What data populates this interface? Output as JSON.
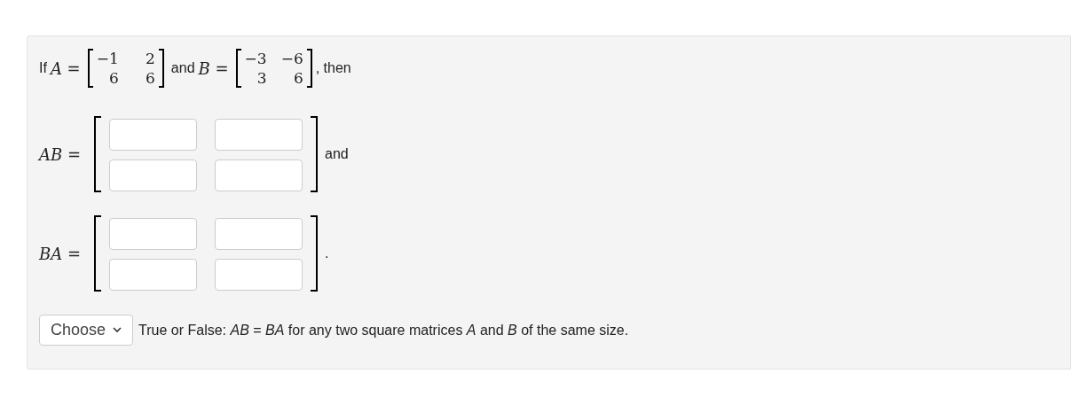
{
  "intro": {
    "prefix": "If",
    "a_label": "*A* =",
    "matrix_a": [
      [
        "−1",
        "2"
      ],
      [
        "6",
        "6"
      ]
    ],
    "middle": "and",
    "b_label": "*B* =",
    "matrix_b": [
      [
        "−3",
        "−6"
      ],
      [
        "3",
        "6"
      ]
    ],
    "suffix": ", then"
  },
  "answers": [
    {
      "label": "*AB* =",
      "after": "and"
    },
    {
      "label": "*BA* =",
      "after": "."
    }
  ],
  "question": {
    "select": "Choose",
    "text": "True or False: *AB* = *BA* for any two square matrices *A* and *B* of the same size."
  }
}
